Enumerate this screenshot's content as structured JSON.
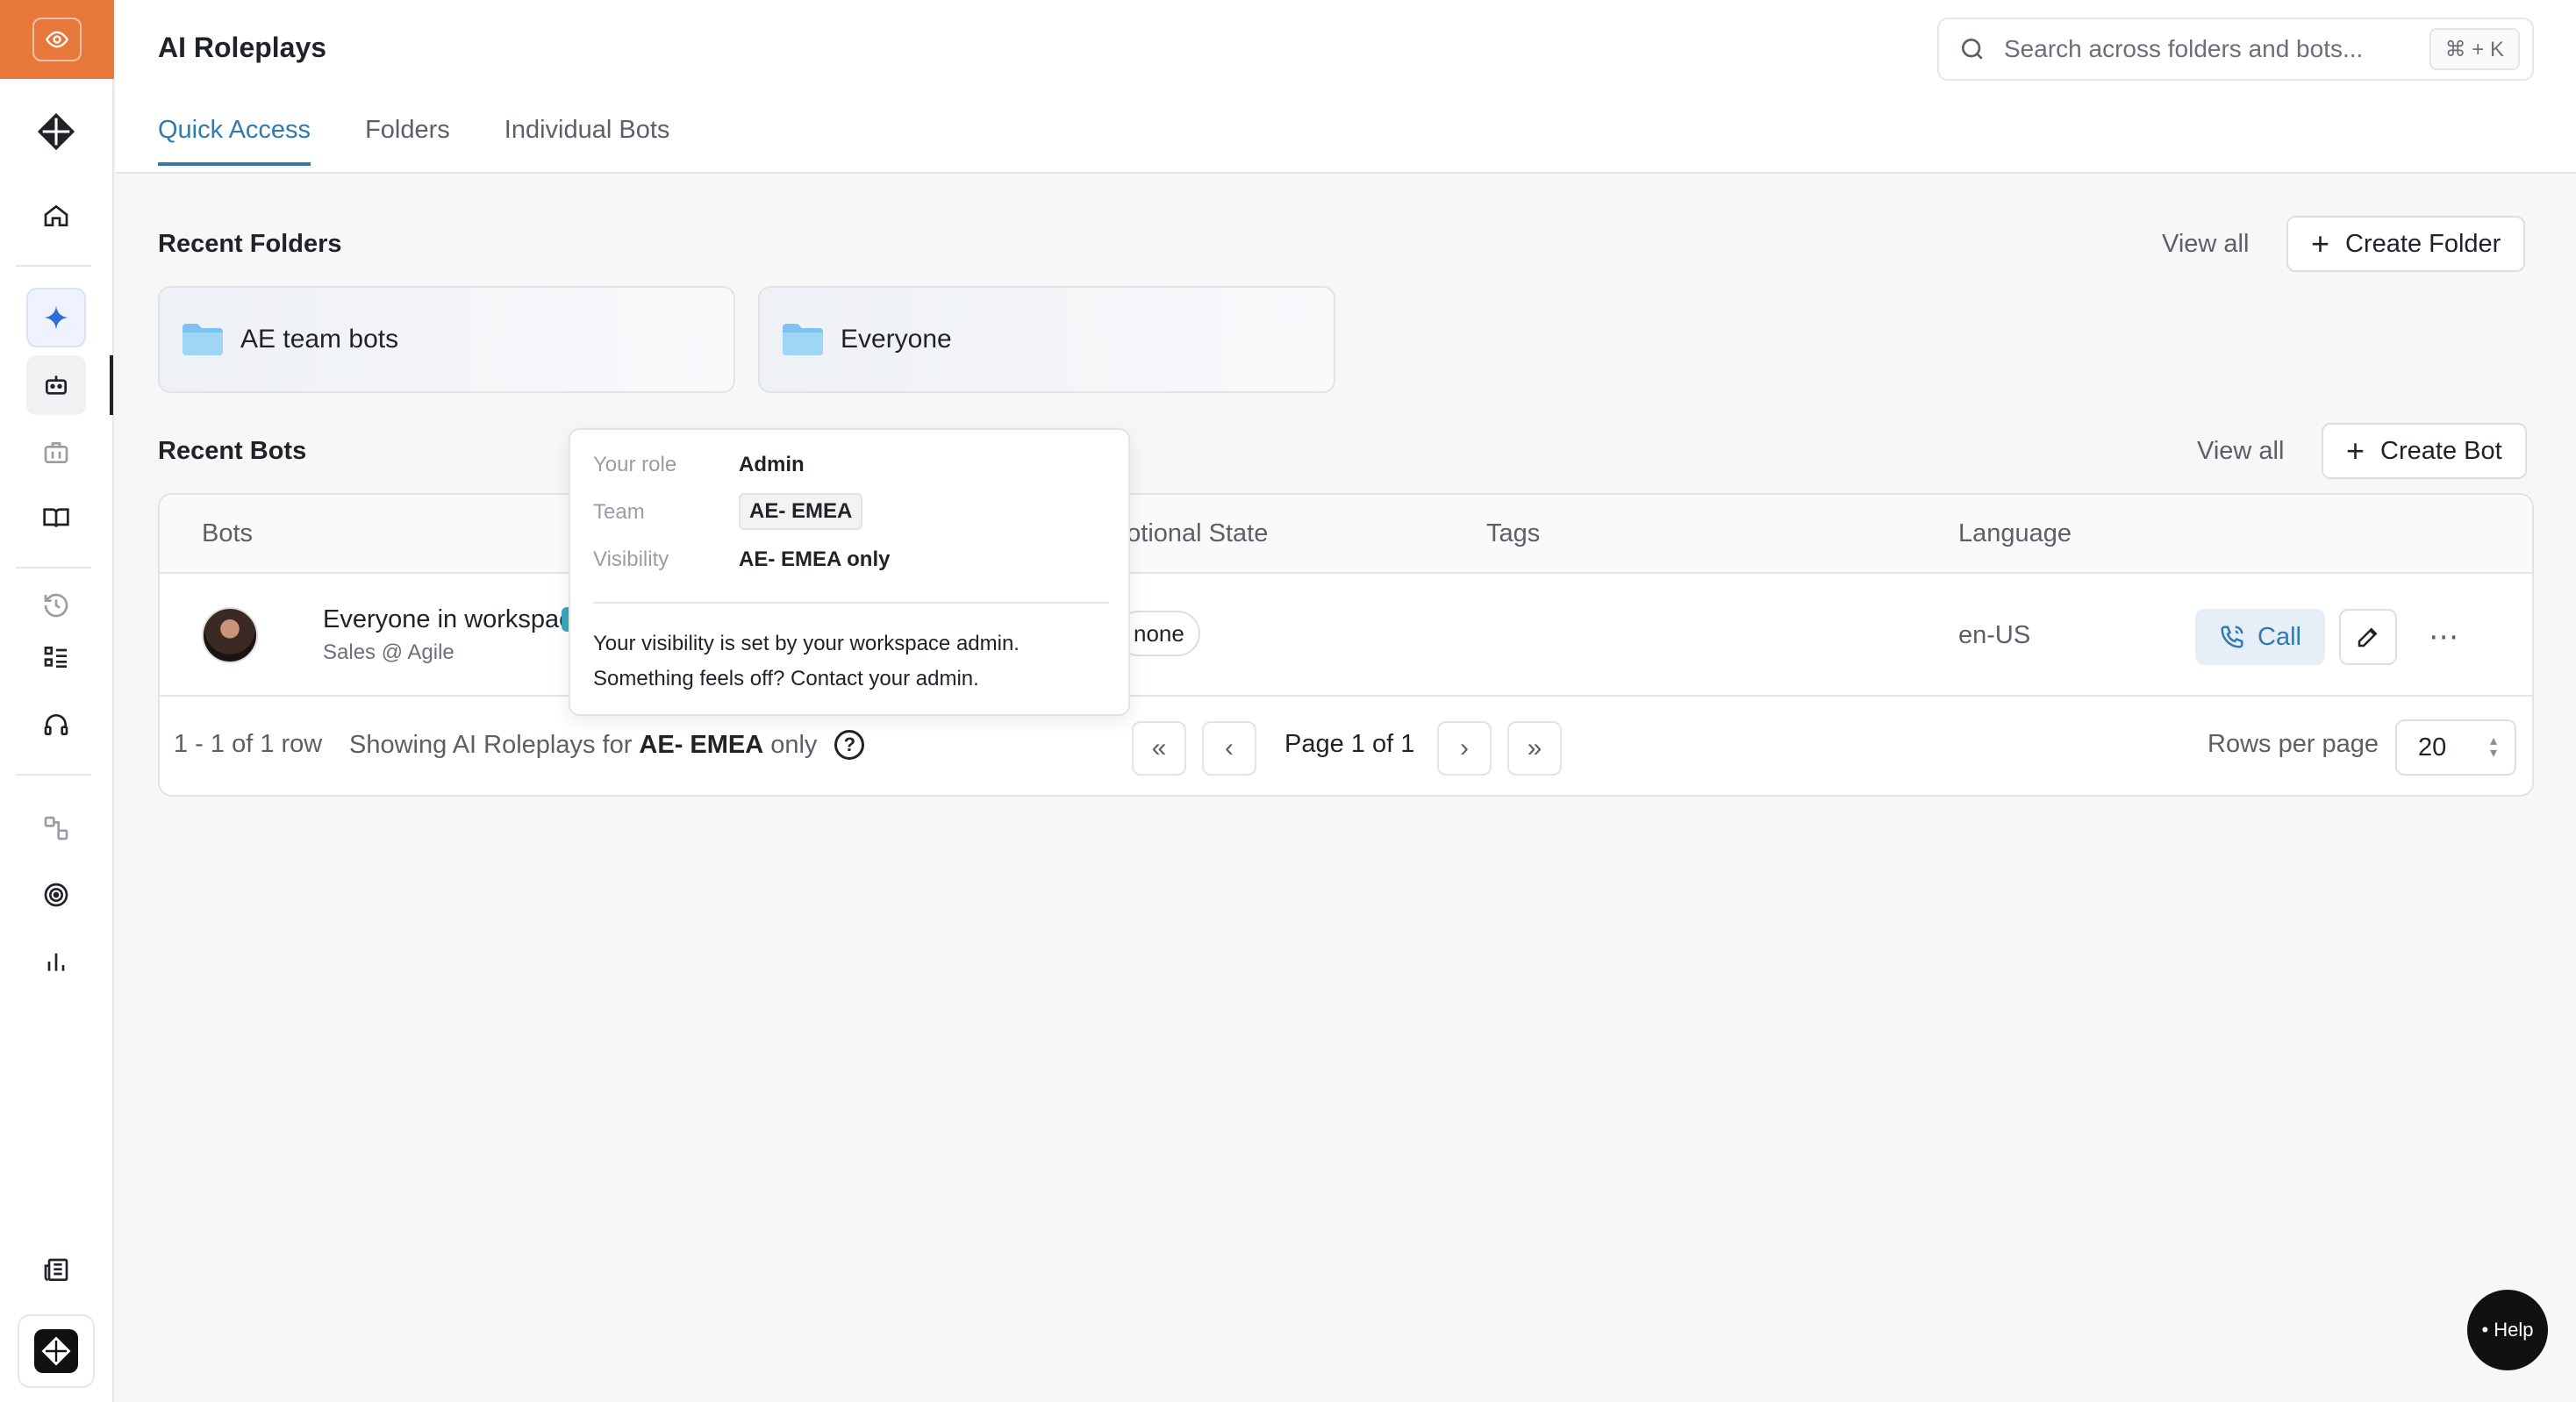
{
  "app": {
    "title": "AI Roleplays",
    "brand_color": "#e8783a",
    "accent_color": "#2f7ab0"
  },
  "sidebar": {
    "items": [
      {
        "name": "home-icon"
      },
      {
        "name": "sparkle-icon",
        "active": true
      },
      {
        "name": "bot-icon",
        "active": true
      },
      {
        "name": "briefcase-icon"
      },
      {
        "name": "book-icon"
      },
      {
        "name": "history-icon"
      },
      {
        "name": "checklist-icon"
      },
      {
        "name": "headset-icon"
      },
      {
        "name": "flow-icon"
      },
      {
        "name": "target-icon"
      },
      {
        "name": "bar-chart-icon"
      },
      {
        "name": "newspaper-icon"
      }
    ]
  },
  "search": {
    "placeholder": "Search across folders and bots...",
    "shortcut": "⌘ + K"
  },
  "tabs": [
    {
      "label": "Quick Access",
      "active": true
    },
    {
      "label": "Folders"
    },
    {
      "label": "Individual Bots"
    }
  ],
  "recent_folders": {
    "title": "Recent Folders",
    "view_all": "View all",
    "create_label": "Create Folder",
    "items": [
      {
        "name": "AE team bots"
      },
      {
        "name": "Everyone"
      }
    ]
  },
  "recent_bots": {
    "title": "Recent Bots",
    "view_all": "View all",
    "create_label": "Create Bot",
    "columns": {
      "bots": "Bots",
      "emotional_state": "notional State",
      "tags": "Tags",
      "language": "Language"
    },
    "rows": [
      {
        "name": "Everyone in workspace",
        "subtitle": "Sales @ Agile",
        "emotional_state": "none",
        "language": "en-US",
        "call_label": "Call"
      }
    ],
    "footer": {
      "row_count": "1 - 1 of 1 row",
      "showing_prefix": "Showing AI Roleplays for",
      "showing_team": "AE- EMEA",
      "showing_suffix": "only",
      "page_label": "Page 1 of 1",
      "rows_per_page_label": "Rows per page",
      "rows_per_page_value": "20"
    }
  },
  "popover": {
    "role_label": "Your role",
    "role_value": "Admin",
    "team_label": "Team",
    "team_value": "AE- EMEA",
    "visibility_label": "Visibility",
    "visibility_value": "AE- EMEA only",
    "note": "Your visibility is set by your workspace admin. Something feels off? Contact your admin."
  },
  "help_fab": {
    "label": "• Help"
  }
}
